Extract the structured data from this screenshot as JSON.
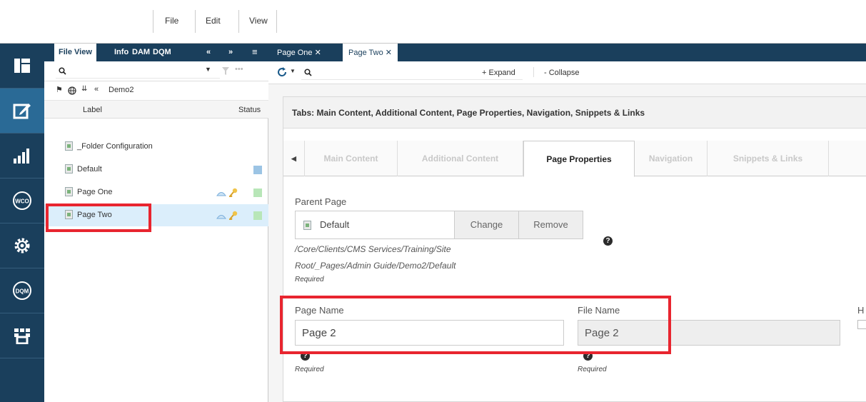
{
  "menu": {
    "file": "File",
    "edit": "Edit",
    "view": "View"
  },
  "rail": {
    "items": [
      "layout-icon",
      "edit-icon",
      "bar-chart-icon",
      "wco-icon",
      "gear-icon",
      "dqm-icon",
      "grid-store-icon"
    ],
    "wco_label": "WCO",
    "dqm_label": "DQM"
  },
  "tree": {
    "tabs": [
      "File View",
      "Info",
      "DAM",
      "DQM"
    ],
    "breadcrumb": "Demo2",
    "col_label": "Label",
    "col_status": "Status",
    "rows": [
      {
        "label": "_Folder Configuration"
      },
      {
        "label": "Default"
      },
      {
        "label": "Page One"
      },
      {
        "label": "Page Two"
      }
    ]
  },
  "doc": {
    "tabs": [
      "Page One",
      "Page Two"
    ],
    "expand": "+ Expand",
    "collapse": "- Collapse",
    "tabs_heading": "Tabs: Main Content, Additional Content, Page Properties, Navigation, Snippets & Links",
    "prop_tabs": [
      "Main Content",
      "Additional Content",
      "Page Properties",
      "Navigation",
      "Snippets & Links"
    ]
  },
  "form": {
    "parent_page_label": "Parent Page",
    "parent_page_value": "Default",
    "change_button": "Change",
    "remove_button": "Remove",
    "parent_path_line1": "/Core/Clients/CMS Services/Training/Site",
    "parent_path_line2": "Root/_Pages/Admin Guide/Demo2/Default",
    "required": "Required",
    "page_name_label": "Page Name",
    "page_name_value": "Page 2",
    "file_name_label": "File Name",
    "file_name_value": "Page 2",
    "cut_label": "H"
  },
  "colors": {
    "rail": "#1a3f5c",
    "rail_active": "#2a6a96",
    "highlight": "#e8252f",
    "status_blue": "#9cc4e4",
    "status_green": "#b8e6b8"
  }
}
